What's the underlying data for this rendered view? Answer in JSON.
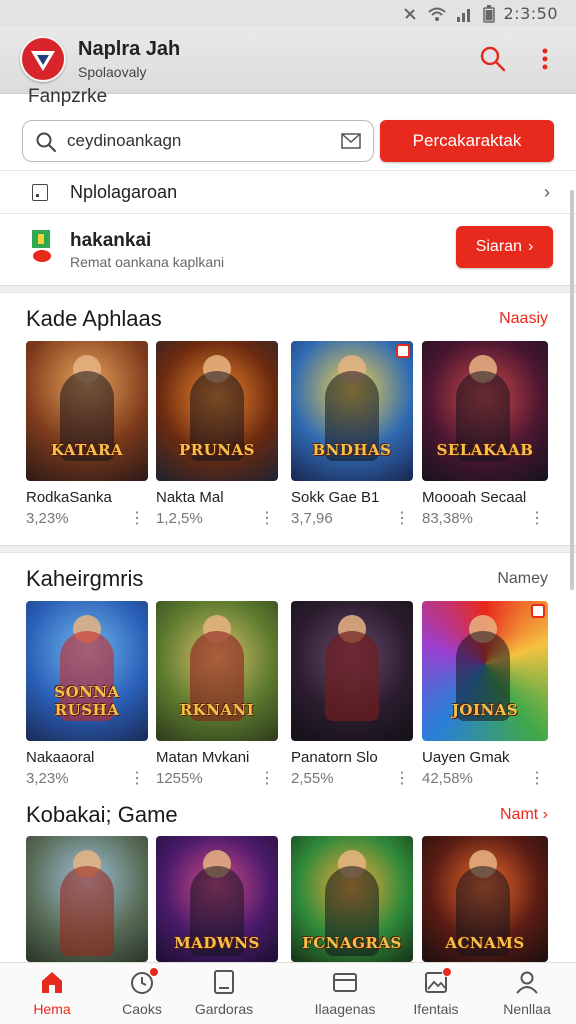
{
  "status_bar": {
    "time": "2:3:50"
  },
  "app_bar": {
    "title": "Naplra Jah",
    "subtitle": "Spolaovaly"
  },
  "peek_text": "Fanpzrke",
  "search": {
    "value": "ceydinoankagn",
    "button_label": "Percakaraktak"
  },
  "list_row": {
    "label": "Nplolagaroan"
  },
  "promo": {
    "title": "hakankai",
    "subtitle": "Remat oankana kaplkani",
    "button_label": "Siaran"
  },
  "sections": [
    {
      "title": "Kade Aphlaas",
      "link": "Naasiy",
      "link_color": "#e8291d",
      "cards": [
        {
          "name": "RodkaSanka",
          "meta": "3,23%",
          "brand": "KATARA"
        },
        {
          "name": "Nakta Mal",
          "meta": "1,2,5%",
          "brand": "PRUNAS"
        },
        {
          "name": "Sokk Gae B1",
          "meta": "3,7,96",
          "brand": "BNDHAS"
        },
        {
          "name": "Moooah Secaal",
          "meta": "83,38%",
          "brand": "SELAKAAB"
        }
      ]
    },
    {
      "title": "Kaheirgmris",
      "link": "Namey",
      "link_color": "#555555",
      "cards": [
        {
          "name": "Nakaaoral",
          "meta": "3,23%",
          "brand": "SONNA RUSHA"
        },
        {
          "name": "Matan Mvkani",
          "meta": "1255%",
          "brand": "RKNANI"
        },
        {
          "name": "Panatorn Slo",
          "meta": "2,55%",
          "brand": ""
        },
        {
          "name": "Uayen Gmak",
          "meta": "42,58%",
          "brand": "JOINAS"
        }
      ]
    },
    {
      "title": "Kobakai; Game",
      "link": "Namt",
      "link_color": "#e8291d",
      "cards": [
        {
          "name": "",
          "meta": "",
          "brand": ""
        },
        {
          "name": "",
          "meta": "",
          "brand": "MADWNS"
        },
        {
          "name": "",
          "meta": "",
          "brand": "FCNAGRAS"
        },
        {
          "name": "",
          "meta": "",
          "brand": "ACNAMS"
        }
      ]
    }
  ],
  "bottom_nav": [
    {
      "label": "Hema",
      "icon": "home-icon"
    },
    {
      "label": "Caoks",
      "icon": "clock-icon"
    },
    {
      "label": "Gardoras",
      "icon": "tablet-icon"
    },
    {
      "label": "Ilaagenas",
      "icon": "card-icon"
    },
    {
      "label": "Ifentais",
      "icon": "gallery-icon"
    },
    {
      "label": "Nenllaa",
      "icon": "profile-icon"
    }
  ],
  "colors": {
    "accent": "#e8291d",
    "background": "#ffffff"
  }
}
